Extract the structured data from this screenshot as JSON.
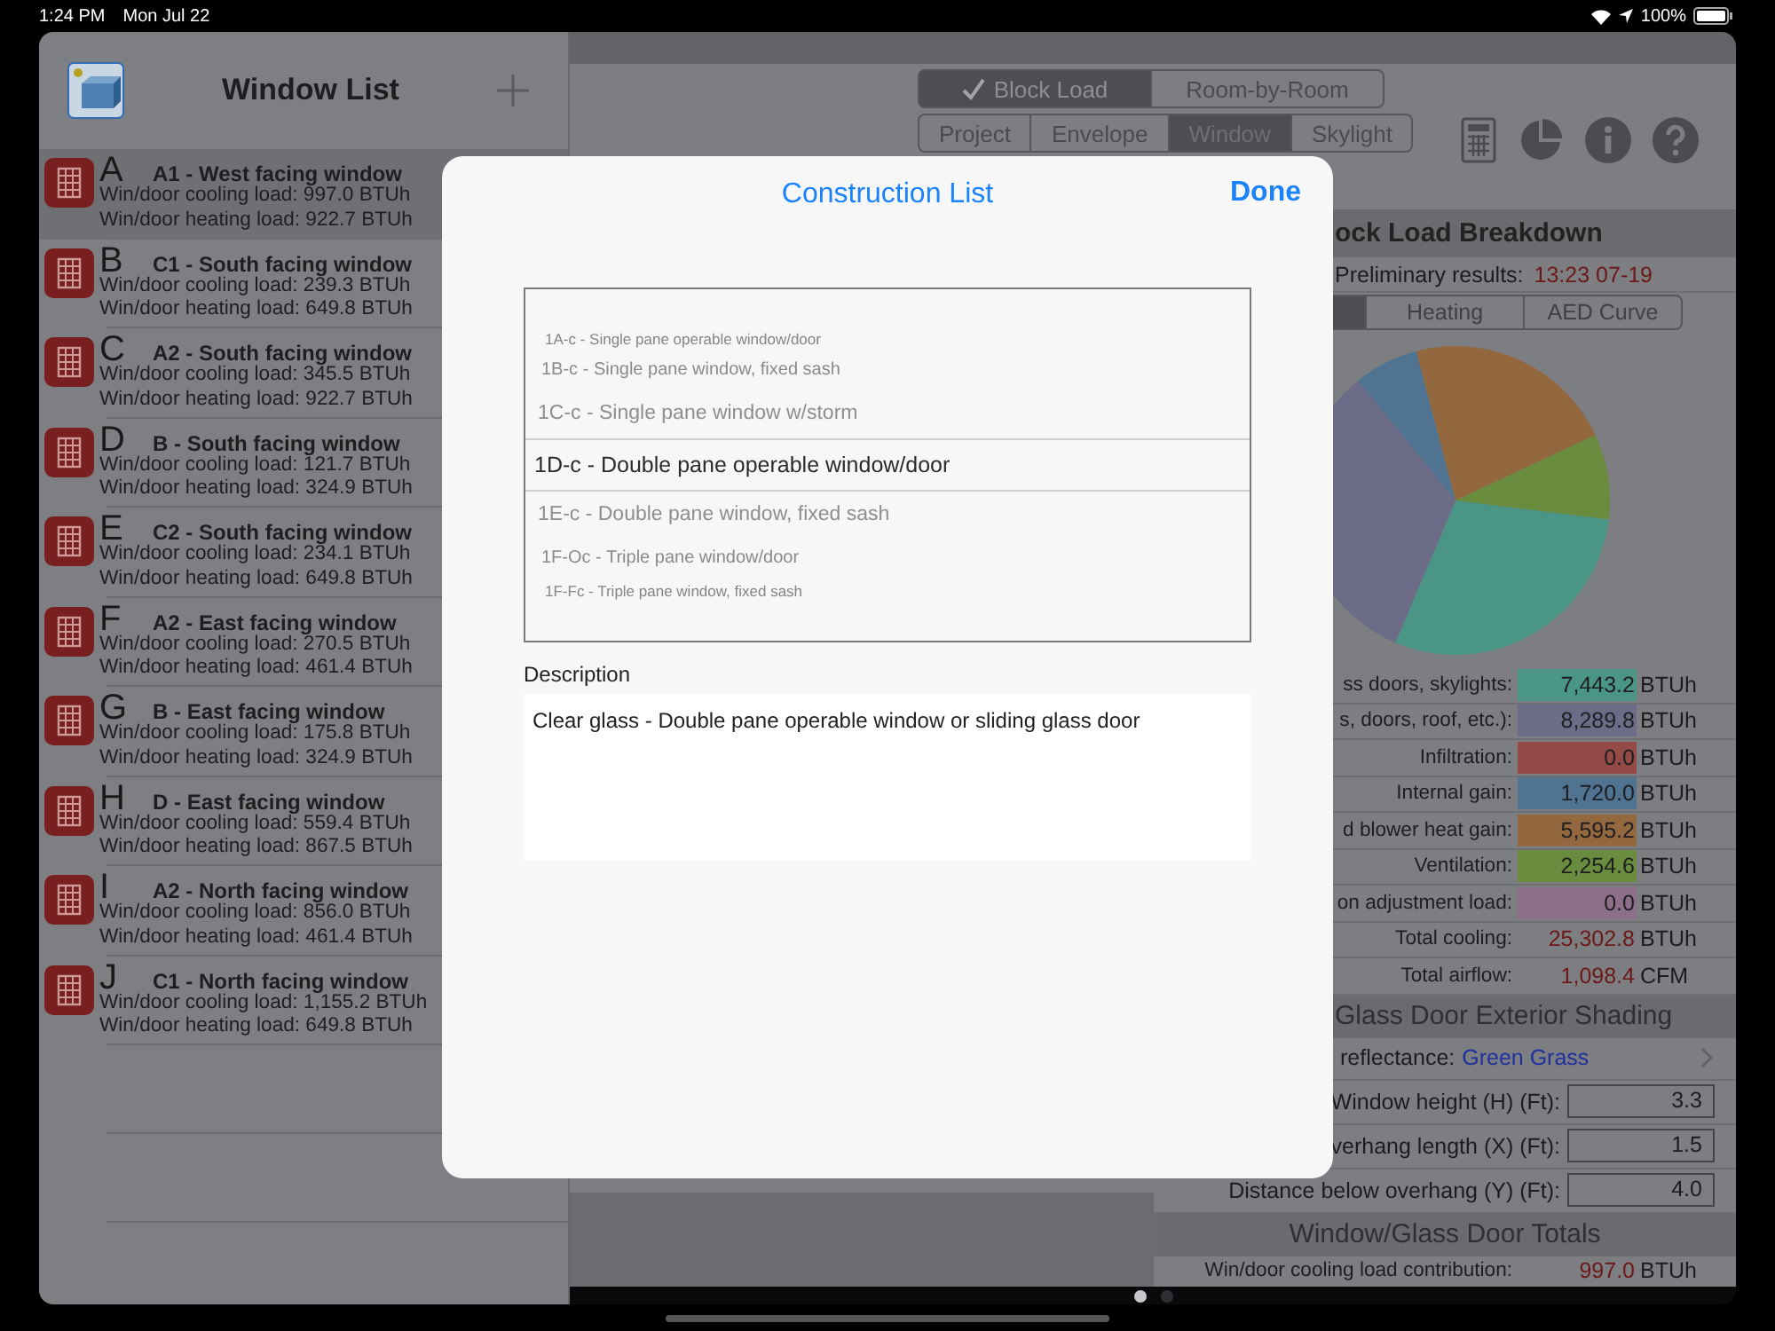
{
  "status_bar": {
    "time": "1:24 PM",
    "date": "Mon Jul 22",
    "battery": "100%"
  },
  "sidebar": {
    "title": "Window List",
    "items": [
      {
        "letter": "A",
        "name": "A1 - West facing window",
        "cooling": "Win/door cooling load: 997.0 BTUh",
        "heating": "Win/door heating load: 922.7 BTUh",
        "selected": true
      },
      {
        "letter": "B",
        "name": "C1 - South facing window",
        "cooling": "Win/door cooling load: 239.3 BTUh",
        "heating": "Win/door heating load: 649.8 BTUh",
        "selected": false
      },
      {
        "letter": "C",
        "name": "A2 - South facing window",
        "cooling": "Win/door cooling load: 345.5 BTUh",
        "heating": "Win/door heating load: 922.7 BTUh",
        "selected": false
      },
      {
        "letter": "D",
        "name": "B - South facing window",
        "cooling": "Win/door cooling load: 121.7 BTUh",
        "heating": "Win/door heating load: 324.9 BTUh",
        "selected": false
      },
      {
        "letter": "E",
        "name": "C2 - South facing window",
        "cooling": "Win/door cooling load: 234.1 BTUh",
        "heating": "Win/door heating load: 649.8 BTUh",
        "selected": false
      },
      {
        "letter": "F",
        "name": "A2 - East facing window",
        "cooling": "Win/door cooling load: 270.5 BTUh",
        "heating": "Win/door heating load: 461.4 BTUh",
        "selected": false
      },
      {
        "letter": "G",
        "name": "B - East facing window",
        "cooling": "Win/door cooling load: 175.8 BTUh",
        "heating": "Win/door heating load: 324.9 BTUh",
        "selected": false
      },
      {
        "letter": "H",
        "name": "D - East facing window",
        "cooling": "Win/door cooling load: 559.4 BTUh",
        "heating": "Win/door heating load: 867.5 BTUh",
        "selected": false
      },
      {
        "letter": "I",
        "name": "A2 - North facing window",
        "cooling": "Win/door cooling load: 856.0 BTUh",
        "heating": "Win/door heating load: 461.4 BTUh",
        "selected": false
      },
      {
        "letter": "J",
        "name": "C1 - North facing window",
        "cooling": "Win/door cooling load: 1,155.2 BTUh",
        "heating": "Win/door heating load: 649.8 BTUh",
        "selected": false
      }
    ]
  },
  "mode_switch": [
    {
      "label": "Block Load",
      "selected": true
    },
    {
      "label": "Room-by-Room",
      "selected": false
    }
  ],
  "section_tabs": [
    {
      "label": "Project",
      "selected": false
    },
    {
      "label": "Envelope",
      "selected": false
    },
    {
      "label": "Window",
      "selected": true
    },
    {
      "label": "Skylight",
      "selected": false
    }
  ],
  "breakdown": {
    "title": "ock Load Breakdown",
    "status_label": "Preliminary results:",
    "status_time": "13:23 07-19",
    "tabs": [
      {
        "label": "Heating",
        "selected": false
      },
      {
        "label": "AED Curve",
        "selected": false
      }
    ],
    "rows": [
      {
        "kind": "chip",
        "label": "ss doors, skylights:",
        "value": "7,443.2",
        "unit": "BTUh",
        "color": "#4a9585"
      },
      {
        "kind": "chip",
        "label": "s, doors, roof, etc.):",
        "value": "8,289.8",
        "unit": "BTUh",
        "color": "#6c6b88"
      },
      {
        "kind": "chip",
        "label": "Infiltration:",
        "value": "0.0",
        "unit": "BTUh",
        "color": "#944a47"
      },
      {
        "kind": "chip",
        "label": "Internal gain:",
        "value": "1,720.0",
        "unit": "BTUh",
        "color": "#4f7391"
      },
      {
        "kind": "chip",
        "label": "d blower heat gain:",
        "value": "5,595.2",
        "unit": "BTUh",
        "color": "#94683f"
      },
      {
        "kind": "chip",
        "label": "Ventilation:",
        "value": "2,254.6",
        "unit": "BTUh",
        "color": "#6a8c3e"
      },
      {
        "kind": "chip",
        "label": "on adjustment load:",
        "value": "0.0",
        "unit": "BTUh",
        "color": "#8e6f8a"
      },
      {
        "kind": "total",
        "label": "Total cooling:",
        "value": "25,302.8",
        "unit": "BTUh"
      },
      {
        "kind": "total",
        "label": "Total airflow:",
        "value": "1,098.4",
        "unit": "CFM"
      }
    ]
  },
  "shading": {
    "title": "Glass Door Exterior Shading",
    "reflectance_label": "reflectance:",
    "reflectance_value": "Green Grass",
    "fields": [
      {
        "label": "Window height (H) (Ft):",
        "value": "3.3"
      },
      {
        "label": "verhang length (X) (Ft):",
        "value": "1.5"
      },
      {
        "label": "Distance below overhang (Y) (Ft):",
        "value": "4.0"
      }
    ]
  },
  "totals": {
    "title": "Window/Glass Door Totals",
    "label": "Win/door cooling load contribution:",
    "value": "997.0",
    "unit": "BTUh"
  },
  "modal": {
    "title": "Construction List",
    "done": "Done",
    "options": [
      {
        "label": "1A-c - Single pane operable window/door",
        "selected": false
      },
      {
        "label": "1B-c - Single pane window, fixed sash",
        "selected": false
      },
      {
        "label": "1C-c - Single pane window w/storm",
        "selected": false
      },
      {
        "label": "1D-c - Double pane operable window/door",
        "selected": true
      },
      {
        "label": "1E-c - Double pane window, fixed sash",
        "selected": false
      },
      {
        "label": "1F-Oc - Triple pane window/door",
        "selected": false
      },
      {
        "label": "1F-Fc - Triple pane window, fixed sash",
        "selected": false
      }
    ],
    "description_label": "Description",
    "description": "Clear glass - Double pane operable window or sliding glass door"
  },
  "pager": [
    {
      "selected": true
    },
    {
      "selected": false
    }
  ]
}
